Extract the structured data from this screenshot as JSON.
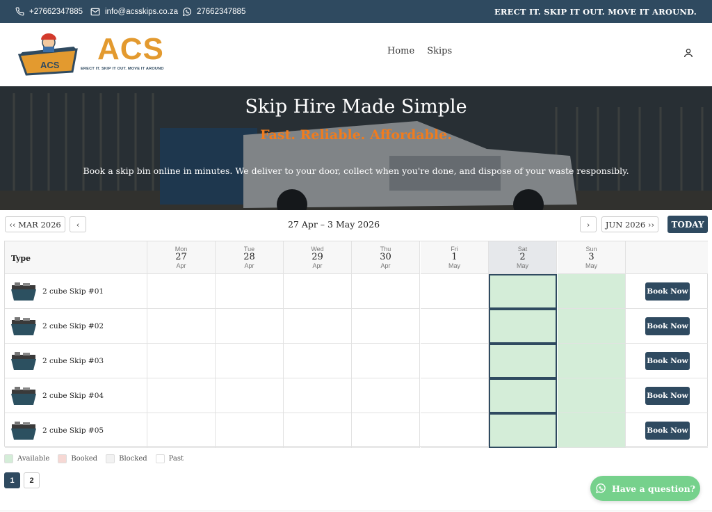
{
  "topbar": {
    "phone": "+27662347885",
    "email": "info@acsskips.co.za",
    "whatsapp": "27662347885",
    "tagline": "ERECT IT. SKIP IT OUT. MOVE IT AROUND."
  },
  "logo": {
    "text": "ACS",
    "box_text": "ACS",
    "slogan": "ERECT IT. SKIP IT OUT. MOVE IT AROUND"
  },
  "nav": {
    "items": [
      "Home",
      "Skips"
    ]
  },
  "hero": {
    "title": "Skip Hire Made Simple",
    "subtitle": "Fast. Reliable. Affordable.",
    "description": "Book a skip bin online in minutes. We deliver to your door, collect when you're done, and dispose of your waste responsibly."
  },
  "calendar": {
    "prev_month": "‹‹ MAR 2026",
    "prev": "‹",
    "range": "27 Apr – 3 May 2026",
    "next": "›",
    "next_month": "JUN 2026 ››",
    "today": "TODAY",
    "type_header": "Type",
    "days": [
      {
        "dow": "Mon",
        "num": "27",
        "mon": "Apr"
      },
      {
        "dow": "Tue",
        "num": "28",
        "mon": "Apr"
      },
      {
        "dow": "Wed",
        "num": "29",
        "mon": "Apr"
      },
      {
        "dow": "Thu",
        "num": "30",
        "mon": "Apr"
      },
      {
        "dow": "Fri",
        "num": "1",
        "mon": "May"
      },
      {
        "dow": "Sat",
        "num": "2",
        "mon": "May"
      },
      {
        "dow": "Sun",
        "num": "3",
        "mon": "May"
      }
    ],
    "rows": [
      {
        "name": "2 cube Skip #01",
        "status": [
          "past",
          "past",
          "past",
          "past",
          "past",
          "available-selected",
          "available"
        ]
      },
      {
        "name": "2 cube Skip #02",
        "status": [
          "past",
          "past",
          "past",
          "past",
          "past",
          "available-selected",
          "available"
        ]
      },
      {
        "name": "2 cube Skip #03",
        "status": [
          "past",
          "past",
          "past",
          "past",
          "past",
          "available-selected",
          "available"
        ]
      },
      {
        "name": "2 cube Skip #04",
        "status": [
          "past",
          "past",
          "past",
          "past",
          "past",
          "available-selected",
          "available"
        ]
      },
      {
        "name": "2 cube Skip #05",
        "status": [
          "past",
          "past",
          "past",
          "past",
          "past",
          "available-selected",
          "available"
        ]
      }
    ],
    "book_label": "Book Now"
  },
  "legend": [
    {
      "label": "Available",
      "color": "#d4edd8"
    },
    {
      "label": "Booked",
      "color": "#f6d8d4"
    },
    {
      "label": "Blocked",
      "color": "#f2f2f2"
    },
    {
      "label": "Past",
      "color": "#ffffff"
    }
  ],
  "pagination": {
    "pages": [
      "1",
      "2"
    ],
    "active": "1"
  },
  "question": {
    "label": "Have a question?"
  },
  "colors": {
    "primary": "#2f4a60",
    "accent": "#e39a2f",
    "hero_sub": "#f07c1e",
    "available": "#d4edd8",
    "whatsapp": "#76d18c"
  }
}
